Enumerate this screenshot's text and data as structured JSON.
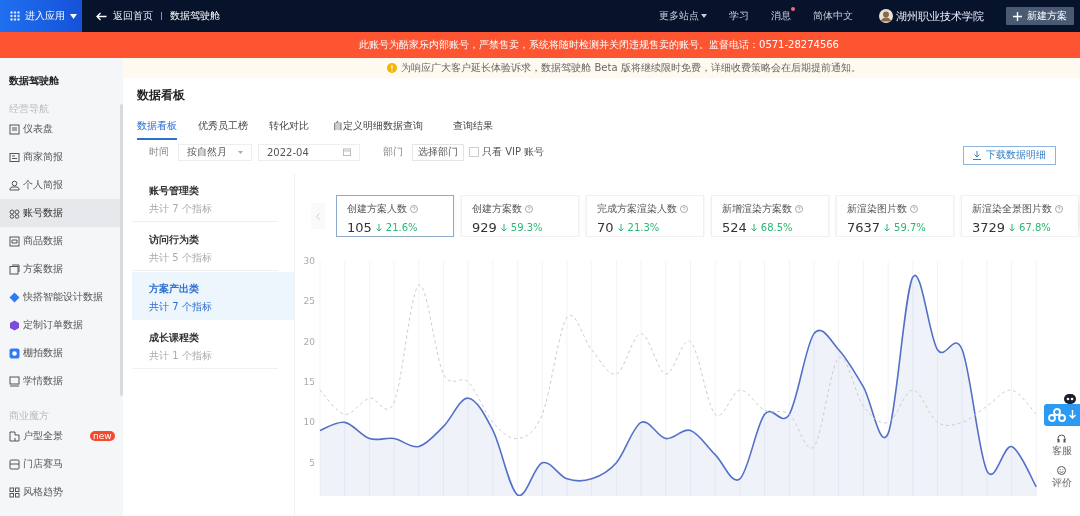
{
  "top_bar": {
    "app_menu": "进入应用",
    "back_link": "返回首页",
    "page_title": "数据驾驶舱",
    "links": [
      {
        "label": "更多站点",
        "dropdown": true,
        "dot": false
      },
      {
        "label": "学习",
        "dropdown": false,
        "dot": false
      },
      {
        "label": "消息",
        "dropdown": false,
        "dot": true
      },
      {
        "label": "简体中文",
        "dropdown": false,
        "dot": false
      }
    ],
    "user": "湖州职业技术学院",
    "new_button": "新建方案"
  },
  "warning_banner": "此账号为酷家乐内部账号，严禁售卖，系统将随时检测并关闭违规售卖的账号。监督电话：0571-28274566",
  "notice": "为响应广大客户延长体验诉求，数据驾驶舱 Beta 版将继续限时免费，详细收费策略会在后期提前通知。",
  "sidebar": {
    "title": "数据驾驶舱",
    "sections": [
      {
        "heading": "经营导航",
        "items": [
          {
            "label": "仪表盘",
            "selected": false
          },
          {
            "label": "商家简报",
            "selected": false
          },
          {
            "label": "个人简报",
            "selected": false
          },
          {
            "label": "账号数据",
            "selected": true
          },
          {
            "label": "商品数据",
            "selected": false
          },
          {
            "label": "方案数据",
            "selected": false
          },
          {
            "label": "快搭智能设计数据",
            "selected": false
          },
          {
            "label": "定制订单数据",
            "selected": false
          },
          {
            "label": "棚拍数据",
            "selected": false
          },
          {
            "label": "学情数据",
            "selected": false
          }
        ]
      },
      {
        "heading": "商业魔方",
        "items": [
          {
            "label": "户型全景",
            "selected": false,
            "badge": "new"
          },
          {
            "label": "门店赛马",
            "selected": false
          },
          {
            "label": "风格趋势",
            "selected": false
          }
        ]
      }
    ]
  },
  "page_heading": "数据看板",
  "tabs": [
    {
      "label": "数据看板",
      "selected": true
    },
    {
      "label": "优秀员工榜",
      "selected": false
    },
    {
      "label": "转化对比",
      "selected": false
    },
    {
      "label": "自定义明细数据查询",
      "selected": false
    },
    {
      "label": "查询结果",
      "selected": false
    }
  ],
  "filters": {
    "time_label": "时间",
    "period": "按自然月",
    "month": "2022-04",
    "department_label": "部门",
    "department_button": "选择部门",
    "vip_only": {
      "label": "只看 VIP 账号",
      "checked": false
    }
  },
  "download_button": "下载数据明细",
  "categories": [
    {
      "title": "账号管理类",
      "subtitle": "共计 7 个指标",
      "selected": false
    },
    {
      "title": "访问行为类",
      "subtitle": "共计 5 个指标",
      "selected": false
    },
    {
      "title": "方案产出类",
      "subtitle": "共计 7 个指标",
      "selected": true
    },
    {
      "title": "成长课程类",
      "subtitle": "共计 1 个指标",
      "selected": false
    }
  ],
  "metrics": [
    {
      "label": "创建方案人数",
      "value": "105",
      "change": "21.6%",
      "selected": true
    },
    {
      "label": "创建方案数",
      "value": "929",
      "change": "59.3%",
      "selected": false
    },
    {
      "label": "完成方案渲染人数",
      "value": "70",
      "change": "21.3%",
      "selected": false
    },
    {
      "label": "新增渲染方案数",
      "value": "524",
      "change": "68.5%",
      "selected": false
    },
    {
      "label": "新渲染图片数",
      "value": "7637",
      "change": "59.7%",
      "selected": false
    },
    {
      "label": "新渲染全景图片数",
      "value": "3729",
      "change": "67.8%",
      "selected": false
    }
  ],
  "chart_data": {
    "type": "line",
    "grid": true,
    "ylim": [
      1,
      30
    ],
    "yticks": [
      5,
      10,
      15,
      20,
      25,
      30
    ],
    "series": [
      {
        "color": "#5470c6",
        "line_style": "solid",
        "values": [
          9,
          10,
          8,
          8,
          7,
          9.5,
          13,
          9,
          1,
          5,
          3,
          3,
          5,
          10,
          8,
          9,
          6,
          3,
          11,
          11,
          21,
          19,
          14.4,
          8.6,
          28,
          19,
          19,
          4,
          7,
          2
        ]
      },
      {
        "color": "#cccccc",
        "line_style": "dashed",
        "values": [
          14,
          11,
          13,
          12.5,
          27,
          16,
          15,
          10,
          8,
          11,
          23,
          19,
          16,
          21,
          16,
          20,
          11,
          14,
          11.5,
          11,
          7,
          18,
          12,
          10,
          14,
          10,
          10,
          12,
          14,
          11
        ]
      }
    ]
  },
  "float_widget": {
    "service": "客服",
    "rating": "评价"
  }
}
